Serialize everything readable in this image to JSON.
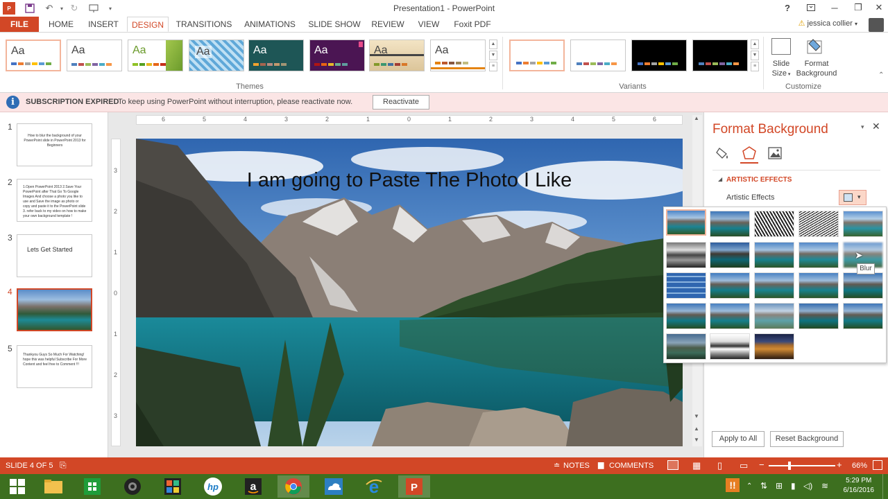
{
  "window": {
    "title": "Presentation1 - PowerPoint",
    "help": "?",
    "user": "jessica collier"
  },
  "tabs": [
    "FILE",
    "HOME",
    "INSERT",
    "DESIGN",
    "TRANSITIONS",
    "ANIMATIONS",
    "SLIDE SHOW",
    "REVIEW",
    "VIEW",
    "Foxit PDF"
  ],
  "active_tab": "DESIGN",
  "ribbon": {
    "themes_label": "Themes",
    "variants_label": "Variants",
    "customize_label": "Customize",
    "theme_sample": "Aa",
    "slide_size": [
      "Slide",
      "Size"
    ],
    "format_background": [
      "Format",
      "Background"
    ]
  },
  "subscription": {
    "heading": "SUBSCRIPTION EXPIRED",
    "message": "To keep using PowerPoint without interruption, please reactivate now.",
    "button": "Reactivate"
  },
  "slides": [
    {
      "num": "1",
      "text": "How to blur the background of your PowerPoint slide in PowerPoint 2013 for Beginners"
    },
    {
      "num": "2",
      "text": "1.Open PowerPoint 2013 2.Save Your PowerPoint after That Go To Google Images And choose a photo you like to use and Save the image as photo or copy and paste it to the PowerPoint slide 3. refer back to my video on how to make your own background template !"
    },
    {
      "num": "3",
      "text": "Lets Get Started"
    },
    {
      "num": "4",
      "text": ""
    },
    {
      "num": "5",
      "text": "Thankyou Guys So Much For Watching! hope this was helpful Subscribe For More Content and feel free to Comment !!!"
    }
  ],
  "ruler": {
    "h": [
      "6",
      "5",
      "4",
      "3",
      "2",
      "1",
      "0",
      "1",
      "2",
      "3",
      "4",
      "5",
      "6"
    ],
    "v": [
      "3",
      "2",
      "1",
      "0",
      "1",
      "2",
      "3"
    ]
  },
  "slide": {
    "caption": "I am going to Paste The Photo I Like"
  },
  "format_pane": {
    "title": "Format Background",
    "section": "ARTISTIC EFFECTS",
    "label": "Artistic Effects",
    "apply_all": "Apply to All",
    "reset": "Reset Background",
    "tooltip": "Blur"
  },
  "status": {
    "slide": "SLIDE 4 OF 5",
    "notes": "NOTES",
    "comments": "COMMENTS",
    "zoom": "66%"
  },
  "taskbar": {
    "time": "5:29 PM",
    "date": "6/16/2016"
  },
  "colors": {
    "accent": "#d24726",
    "taskbar": "#3d6f1f",
    "info": "#2f6db5"
  }
}
